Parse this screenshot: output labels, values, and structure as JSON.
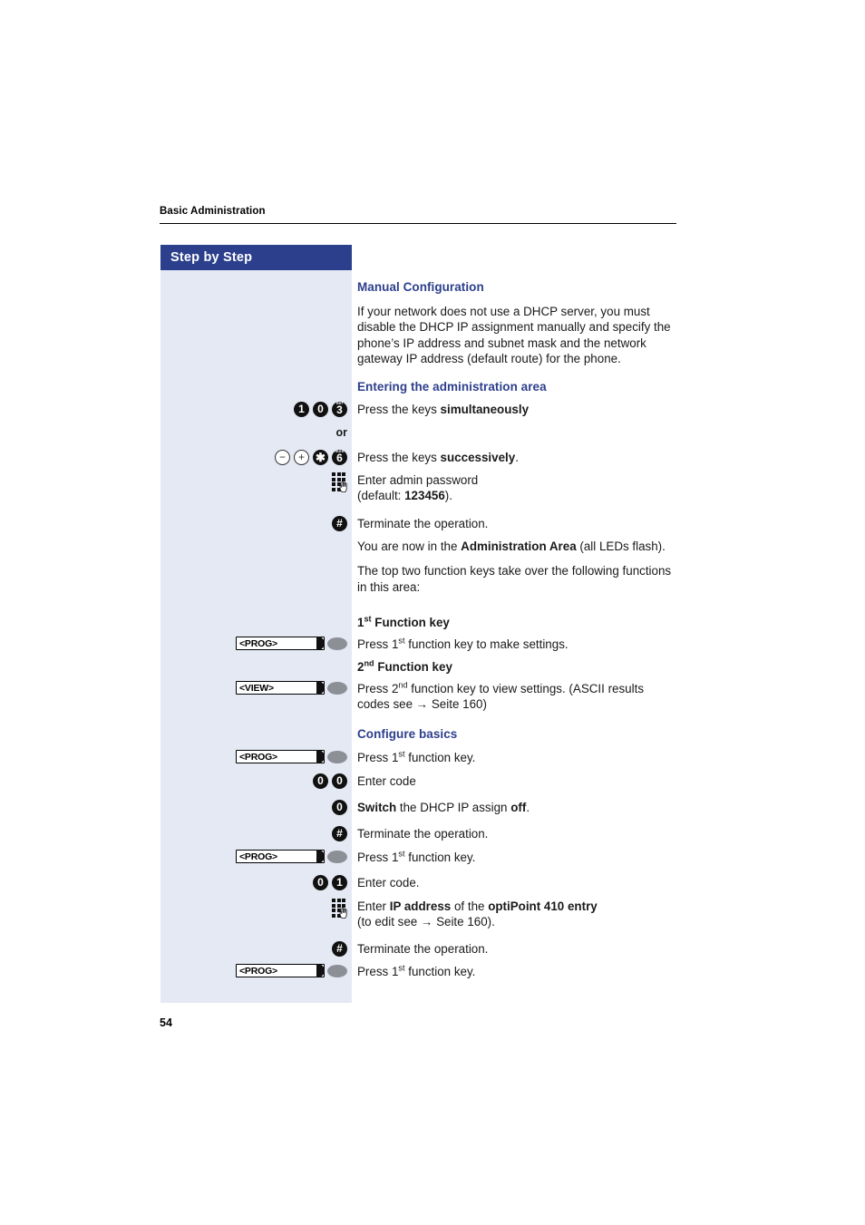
{
  "page": {
    "running_head": "Basic Administration",
    "folio": "54",
    "sidebar_title": "Step by Step",
    "colors": {
      "brand_blue": "#2c3f8c",
      "panel_bg": "#e4e9f4",
      "heading_blue": "#2c3f8c",
      "lamp_gray": "#8c8f96"
    }
  },
  "sections": {
    "manual_configuration": {
      "heading": "Manual Configuration",
      "paragraph": "If your network does not use a DHCP server, you must disable the DHCP IP assignment manually and specify the phone’s IP address and subnet mask and the network gateway IP address (default route) for the phone."
    },
    "entering_admin_area": {
      "heading": "Entering the administration area",
      "or_label": "or",
      "steps": [
        {
          "keys": [
            "1",
            "0",
            "3"
          ],
          "key_letters": [
            "",
            "",
            "def"
          ],
          "text_prefix": "Press the keys ",
          "text_bold": "simultaneously",
          "text_suffix": ""
        },
        {
          "keys": [
            "−",
            "+",
            "✱",
            "6"
          ],
          "key_letters": [
            "",
            "",
            "",
            "mno"
          ],
          "text_prefix": "Press the keys ",
          "text_bold": "successively",
          "text_suffix": "."
        },
        {
          "icon": "keypad-icon",
          "text_line1": "Enter admin password",
          "text_line2_prefix": "(default: ",
          "text_line2_bold": "123456",
          "text_line2_suffix": ")."
        },
        {
          "icon": "hash-key-icon",
          "text": "Terminate the operation."
        }
      ],
      "after_text_prefix": "You are now in the ",
      "after_text_bold": "Administration Area",
      "after_text_suffix": " (all LEDs flash).",
      "intro_functions": "The top two function keys take over the following functions in this area:"
    },
    "function_keys": {
      "first": {
        "heading_num": "1",
        "heading_sup": "st",
        "heading_rest": " Function key",
        "button_label": "<PROG>",
        "text_prefix": "Press 1",
        "text_sup": "st",
        "text_suffix": " function key to make settings."
      },
      "second": {
        "heading_num": "2",
        "heading_sup": "nd",
        "heading_rest": " Function key",
        "button_label": "<VIEW>",
        "text_prefix": "Press 2",
        "text_sup": "nd",
        "text_suffix": " function key to view settings. (ASCII results codes see → Seite 160)"
      }
    },
    "configure_basics": {
      "heading": "Configure basics",
      "steps": [
        {
          "widget": "fkey",
          "button_label": "<PROG>",
          "text_prefix": "Press 1",
          "text_sup": "st",
          "text_suffix": " function key."
        },
        {
          "keys": [
            "0",
            "0"
          ],
          "text": "Enter code"
        },
        {
          "keys": [
            "0"
          ],
          "text_prefix": "",
          "text_bold1": "Switch",
          "text_mid": " the DHCP IP assign ",
          "text_bold2": "off",
          "text_suffix": "."
        },
        {
          "icon": "hash-key-icon",
          "text": "Terminate the operation."
        },
        {
          "widget": "fkey",
          "button_label": "<PROG>",
          "text_prefix": "Press 1",
          "text_sup": "st",
          "text_suffix": " function key."
        },
        {
          "keys": [
            "0",
            "1"
          ],
          "text": "Enter code."
        },
        {
          "icon": "keypad-icon",
          "text_line1_prefix": "Enter ",
          "text_line1_bold1": "IP address",
          "text_line1_mid": " of the ",
          "text_line1_bold2": "optiPoint 410 entry",
          "text_line2": "(to edit see → Seite 160)."
        },
        {
          "icon": "hash-key-icon",
          "text": "Terminate the operation."
        },
        {
          "widget": "fkey",
          "button_label": "<PROG>",
          "text_prefix": "Press 1",
          "text_sup": "st",
          "text_suffix": " function key."
        }
      ]
    }
  }
}
